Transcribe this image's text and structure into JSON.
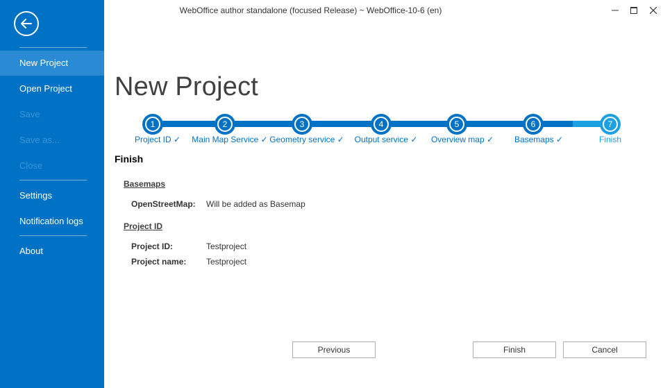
{
  "window": {
    "title": "WebOffice author standalone (focused Release) ~ WebOffice-10-6 (en)",
    "controls": [
      "minimize-icon",
      "maximize-icon",
      "close-icon"
    ]
  },
  "sidebar": {
    "back_icon": "arrow-left-icon",
    "items": [
      {
        "label": "New Project",
        "state": "active"
      },
      {
        "label": "Open Project",
        "state": "enabled"
      },
      {
        "label": "Save",
        "state": "disabled"
      },
      {
        "label": "Save as...",
        "state": "disabled"
      },
      {
        "label": "Close",
        "state": "disabled"
      },
      {
        "label": "Settings",
        "state": "enabled"
      },
      {
        "label": "Notification logs",
        "state": "enabled"
      },
      {
        "label": "About",
        "state": "enabled"
      }
    ]
  },
  "main": {
    "page_title": "New Project",
    "steps": [
      {
        "number": "1",
        "label": "Project ID ✓"
      },
      {
        "number": "2",
        "label": "Main Map Service ✓"
      },
      {
        "number": "3",
        "label": "Geometry service ✓"
      },
      {
        "number": "4",
        "label": "Output service ✓"
      },
      {
        "number": "5",
        "label": "Overview map ✓"
      },
      {
        "number": "6",
        "label": "Basemaps ✓"
      },
      {
        "number": "7",
        "label": "Finish"
      }
    ],
    "current_step": 7,
    "section_title": "Finish",
    "summary": {
      "basemaps": {
        "heading": "Basemaps",
        "rows": [
          {
            "key": "OpenStreetMap:",
            "value": "Will be added as Basemap"
          }
        ]
      },
      "project_id": {
        "heading": "Project ID",
        "rows": [
          {
            "key": "Project ID:",
            "value": "Testproject"
          },
          {
            "key": "Project name:",
            "value": "Testproject"
          }
        ]
      }
    },
    "buttons": {
      "previous": "Previous",
      "finish": "Finish",
      "cancel": "Cancel"
    }
  },
  "colors": {
    "sidebar_bg": "#0072c6",
    "sidebar_active": "#2a8ad4",
    "sidebar_disabled_text": "#3a94da",
    "step_done": "#0072c6",
    "step_current": "#1ba1e2"
  }
}
